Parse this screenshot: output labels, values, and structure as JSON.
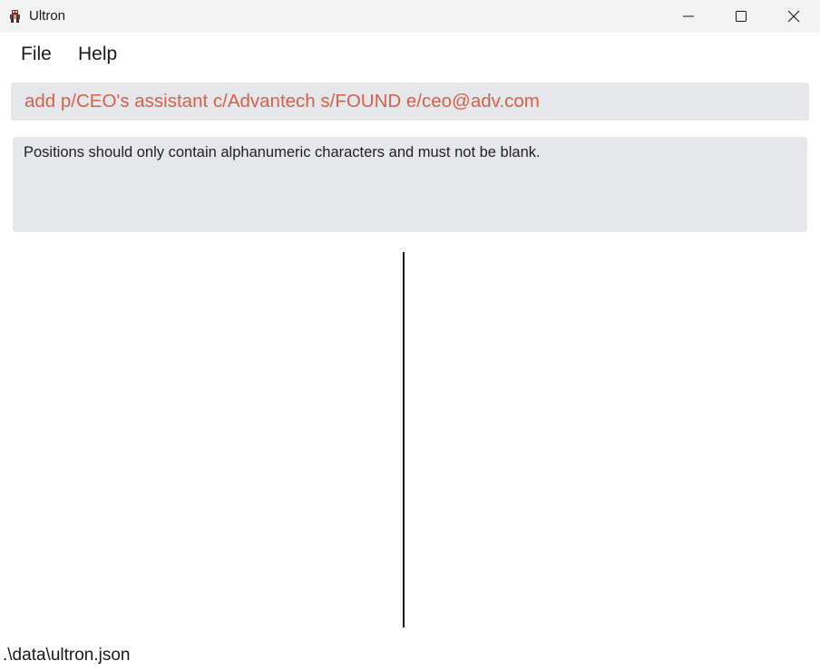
{
  "window": {
    "title": "Ultron",
    "icon": "ultron-app-icon"
  },
  "menu": {
    "items": [
      {
        "label": "File"
      },
      {
        "label": "Help"
      }
    ]
  },
  "command": {
    "value": "add p/CEO's assistant c/Advantech s/FOUND e/ceo@adv.com",
    "color": "#d5614a"
  },
  "result": {
    "message": "Positions should only contain alphanumeric characters and must not be blank."
  },
  "status": {
    "file_path": ".\\data\\ultron.json"
  },
  "colors": {
    "titlebar": "#f3f3f3",
    "panel": "#e6e7ea",
    "error_text": "#d5614a"
  }
}
